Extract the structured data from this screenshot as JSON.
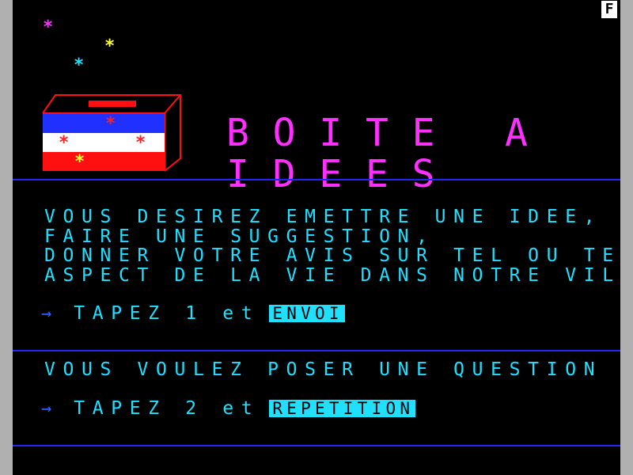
{
  "header": {
    "badge": "F",
    "title": "BOITE A IDEES"
  },
  "decor": {
    "star_glyph": "*",
    "star_colors": [
      "#ff30ff",
      "#ffff30",
      "#20e0ff"
    ]
  },
  "section1": {
    "lines": [
      "VOUS DESIREZ EMETTRE UNE IDEE,",
      "FAIRE UNE SUGGESTION,",
      "DONNER VOTRE AVIS SUR TEL OU TEL",
      "ASPECT DE LA VIE DANS NOTRE VILLE ?"
    ],
    "action_prefix": "TAPEZ 1 et",
    "action_key": "ENVOI"
  },
  "section2": {
    "question": "VOUS VOULEZ POSER UNE QUESTION ?",
    "action_prefix": "TAPEZ 2 et",
    "action_key": "REPETITION"
  },
  "colors": {
    "text": "#20e0ff",
    "title": "#ff30ff",
    "rule": "#2222ff",
    "arrow": "#2f5cff",
    "flag_blue": "#2030ff",
    "flag_white": "#ffffff",
    "flag_red": "#ff1010"
  }
}
